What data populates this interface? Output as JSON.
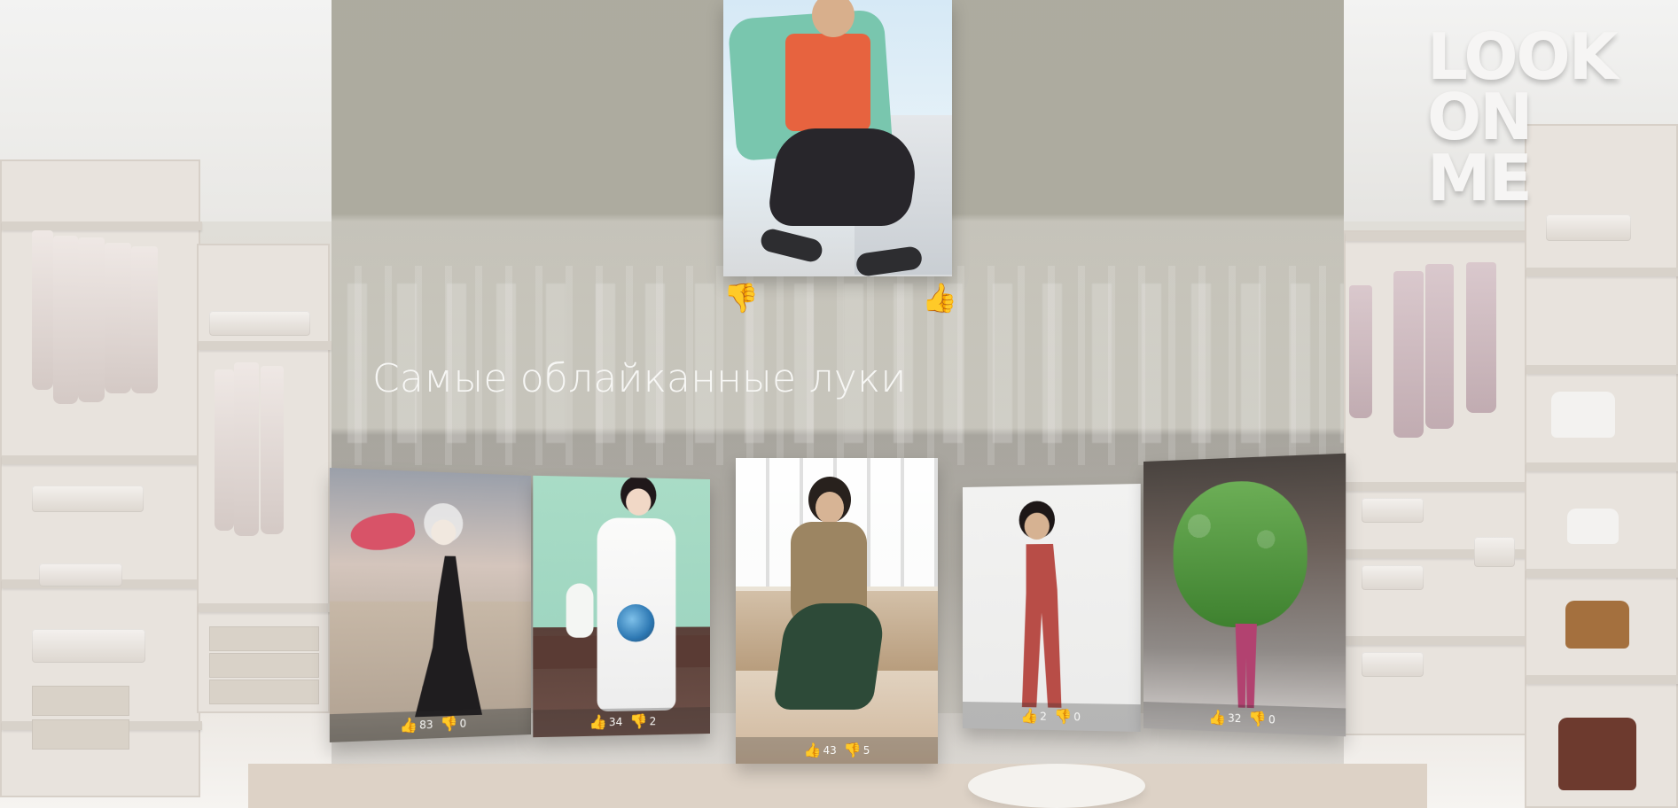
{
  "logo": {
    "line1": "LOOK",
    "line2": "ON",
    "line3": "ME"
  },
  "section": {
    "title": "Самые облайканные луки"
  },
  "featured_look": {
    "dislike_icon": "👎",
    "like_icon": "👍"
  },
  "looks": [
    {
      "likes": "83",
      "dislikes": "0",
      "like_icon": "👍",
      "dislike_icon": "👎"
    },
    {
      "likes": "34",
      "dislikes": "2",
      "like_icon": "👍",
      "dislike_icon": "👎"
    },
    {
      "likes": "43",
      "dislikes": "5",
      "like_icon": "👍",
      "dislike_icon": "👎"
    },
    {
      "likes": "2",
      "dislikes": "0",
      "like_icon": "👍",
      "dislike_icon": "👎"
    },
    {
      "likes": "32",
      "dislikes": "0",
      "like_icon": "👍",
      "dislike_icon": "👎"
    }
  ],
  "colors": {
    "accent": "#f4b400",
    "panel": "#aca99e",
    "title": "#f7f7f5"
  }
}
